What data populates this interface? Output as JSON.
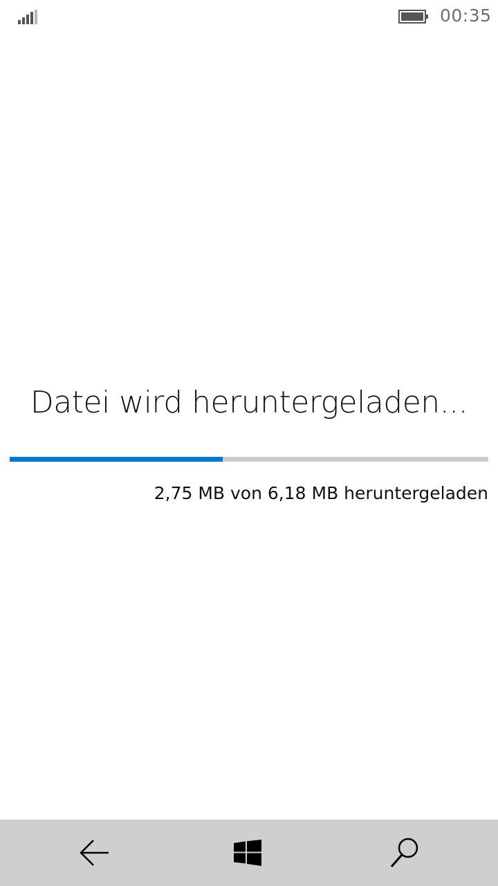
{
  "status_bar": {
    "time": "00:35",
    "signal_icon": "signal-strength-icon",
    "battery_icon": "battery-icon"
  },
  "download": {
    "title": "Datei wird heruntergeladen...",
    "progress_fraction": 0.445,
    "status_text": "2,75 MB von 6,18 MB heruntergeladen",
    "accent_color": "#0078d7",
    "track_color": "#cccccc"
  },
  "nav_bar": {
    "back_icon": "back-arrow-icon",
    "home_icon": "windows-logo-icon",
    "search_icon": "search-icon",
    "background_color": "#cfcfcf"
  }
}
